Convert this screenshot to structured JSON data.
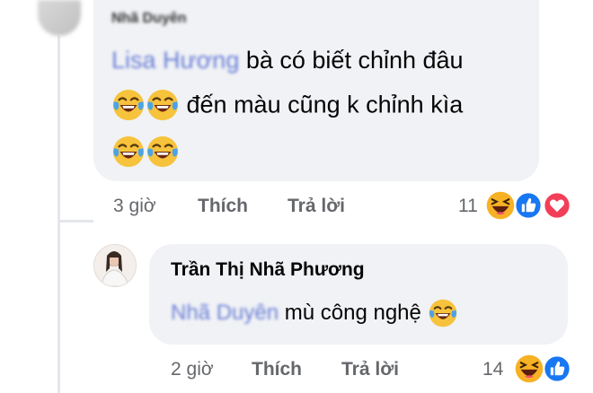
{
  "colors": {
    "bubble": "#f0f2f5",
    "meta_text": "#65676b",
    "like_blue": "#1877f2",
    "love_red": "#f33e58",
    "haha_yellow": "#f7b125"
  },
  "comment1": {
    "author": "Nhã Duyên",
    "mention": "Lisa Hương",
    "line1": "bà có biết chỉnh đâu",
    "line2": "đến màu cũng k chỉnh kìa",
    "time": "3 giờ",
    "like_label": "Thích",
    "reply_label": "Trả lời",
    "reaction_count": "11",
    "reactions": [
      "haha-icon",
      "like-icon",
      "love-icon"
    ]
  },
  "reply1": {
    "author": "Trần Thị Nhã Phương",
    "mention": "Nhã Duyên",
    "text": "mù công nghệ",
    "time": "2 giờ",
    "like_label": "Thích",
    "reply_label": "Trả lời",
    "reaction_count": "14",
    "reactions": [
      "haha-icon",
      "like-icon"
    ]
  }
}
